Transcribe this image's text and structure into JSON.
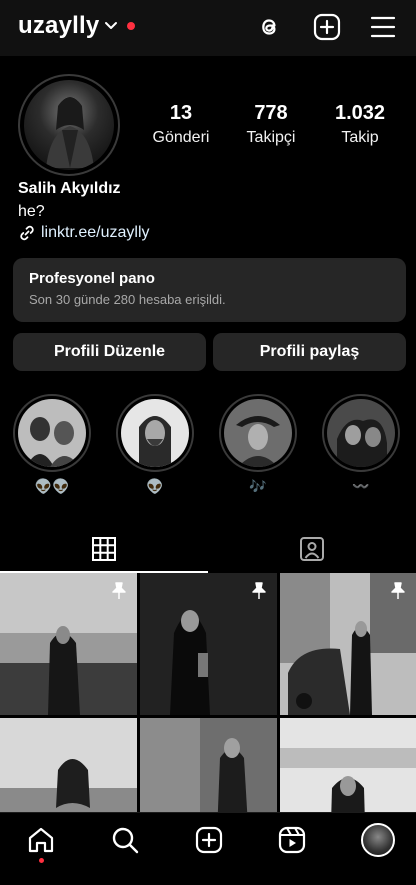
{
  "header": {
    "username": "uzaylly",
    "icons": [
      "threads-icon",
      "plus-square-icon",
      "menu-icon"
    ]
  },
  "profile": {
    "stats": [
      {
        "value": "13",
        "label": "Gönderi"
      },
      {
        "value": "778",
        "label": "Takipçi"
      },
      {
        "value": "1.032",
        "label": "Takip"
      }
    ],
    "name": "Salih Akyıldız",
    "bio": "he?",
    "link": "linktr.ee/uzaylly"
  },
  "dashboard": {
    "title": "Profesyonel pano",
    "subtitle": "Son 30 günde 280 hesaba erişildi."
  },
  "buttons": {
    "edit": "Profili Düzenle",
    "share": "Profili paylaş"
  },
  "highlights": [
    {
      "label": "👽👽"
    },
    {
      "label": "👽"
    },
    {
      "label": "🎶"
    },
    {
      "label": "〰️"
    }
  ],
  "tabs": [
    "grid-icon",
    "tagged-icon"
  ],
  "bottom_nav": [
    "home-icon",
    "search-icon",
    "create-icon",
    "reels-icon",
    "profile-avatar"
  ],
  "colors": {
    "background": "#000000",
    "surface": "#262626",
    "accent_red": "#ff3040",
    "link": "#e0f1ff"
  }
}
